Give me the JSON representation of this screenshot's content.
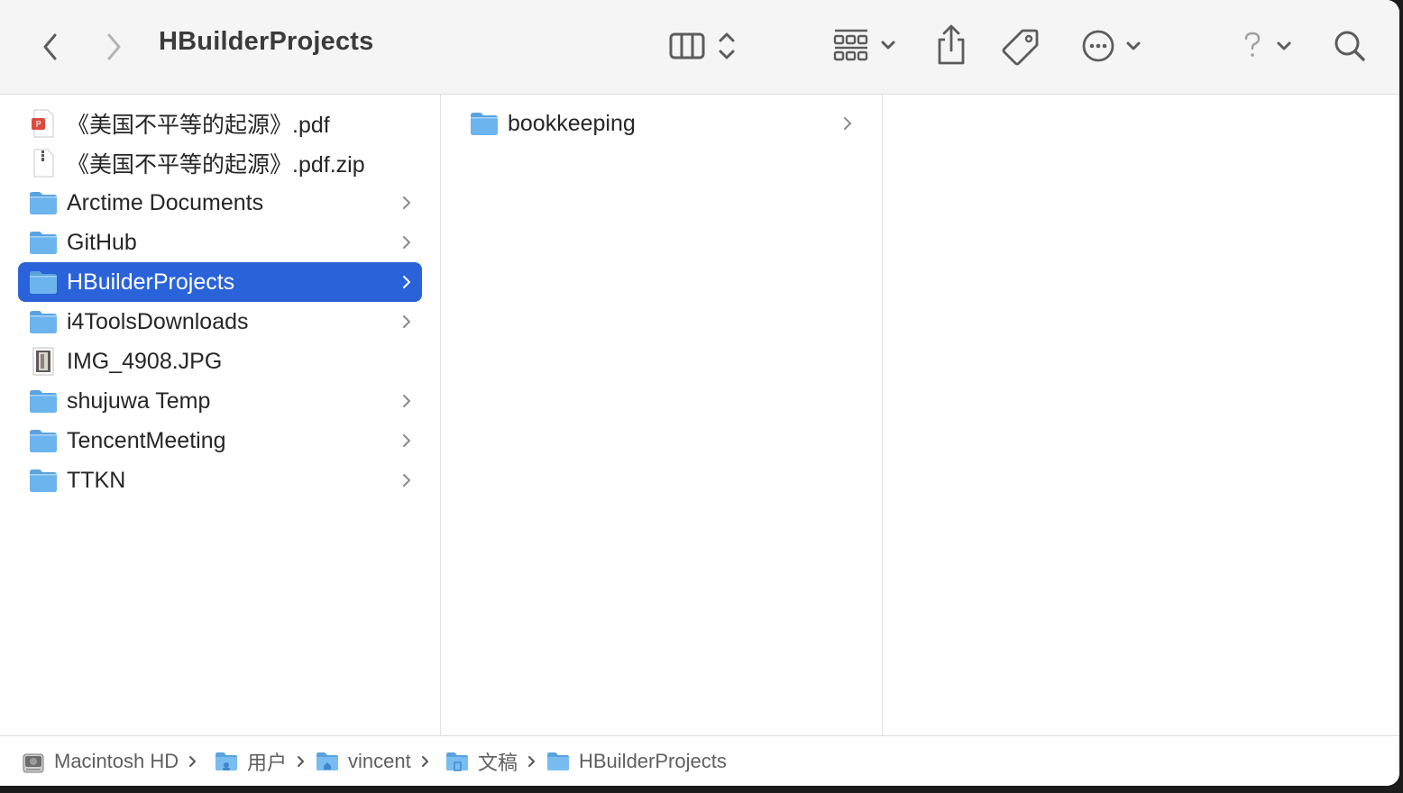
{
  "window": {
    "title": "HBuilderProjects"
  },
  "toolbar": {
    "icons": [
      "chevron-left-icon",
      "chevron-right-icon",
      "column-view-icon",
      "up-down-icon",
      "grid-group-icon",
      "chevron-down-icon",
      "share-icon",
      "tag-icon",
      "more-icon",
      "help-icon",
      "search-icon"
    ]
  },
  "column1": {
    "items": [
      {
        "label": "《美国不平等的起源》.pdf",
        "kind": "pdf"
      },
      {
        "label": "《美国不平等的起源》.pdf.zip",
        "kind": "zip"
      },
      {
        "label": "Arctime Documents",
        "kind": "folder"
      },
      {
        "label": "GitHub",
        "kind": "folder"
      },
      {
        "label": "HBuilderProjects",
        "kind": "folder",
        "selected": true
      },
      {
        "label": "i4ToolsDownloads",
        "kind": "folder"
      },
      {
        "label": "IMG_4908.JPG",
        "kind": "image"
      },
      {
        "label": "shujuwa Temp",
        "kind": "folder"
      },
      {
        "label": "TencentMeeting",
        "kind": "folder"
      },
      {
        "label": "TTKN",
        "kind": "folder"
      }
    ]
  },
  "column2": {
    "items": [
      {
        "label": "bookkeeping",
        "kind": "folder"
      }
    ]
  },
  "pathbar": {
    "crumbs": [
      {
        "label": "Macintosh HD",
        "icon": "hard-drive-icon"
      },
      {
        "label": "用户",
        "icon": "users-folder-icon"
      },
      {
        "label": "vincent",
        "icon": "home-folder-icon"
      },
      {
        "label": "文稿",
        "icon": "documents-folder-icon"
      },
      {
        "label": "HBuilderProjects",
        "icon": "folder-icon"
      }
    ]
  },
  "colors": {
    "selection": "#2a62d9",
    "folder_blue": "#6cb4ee",
    "toolbar_bg": "#f6f5f6"
  }
}
